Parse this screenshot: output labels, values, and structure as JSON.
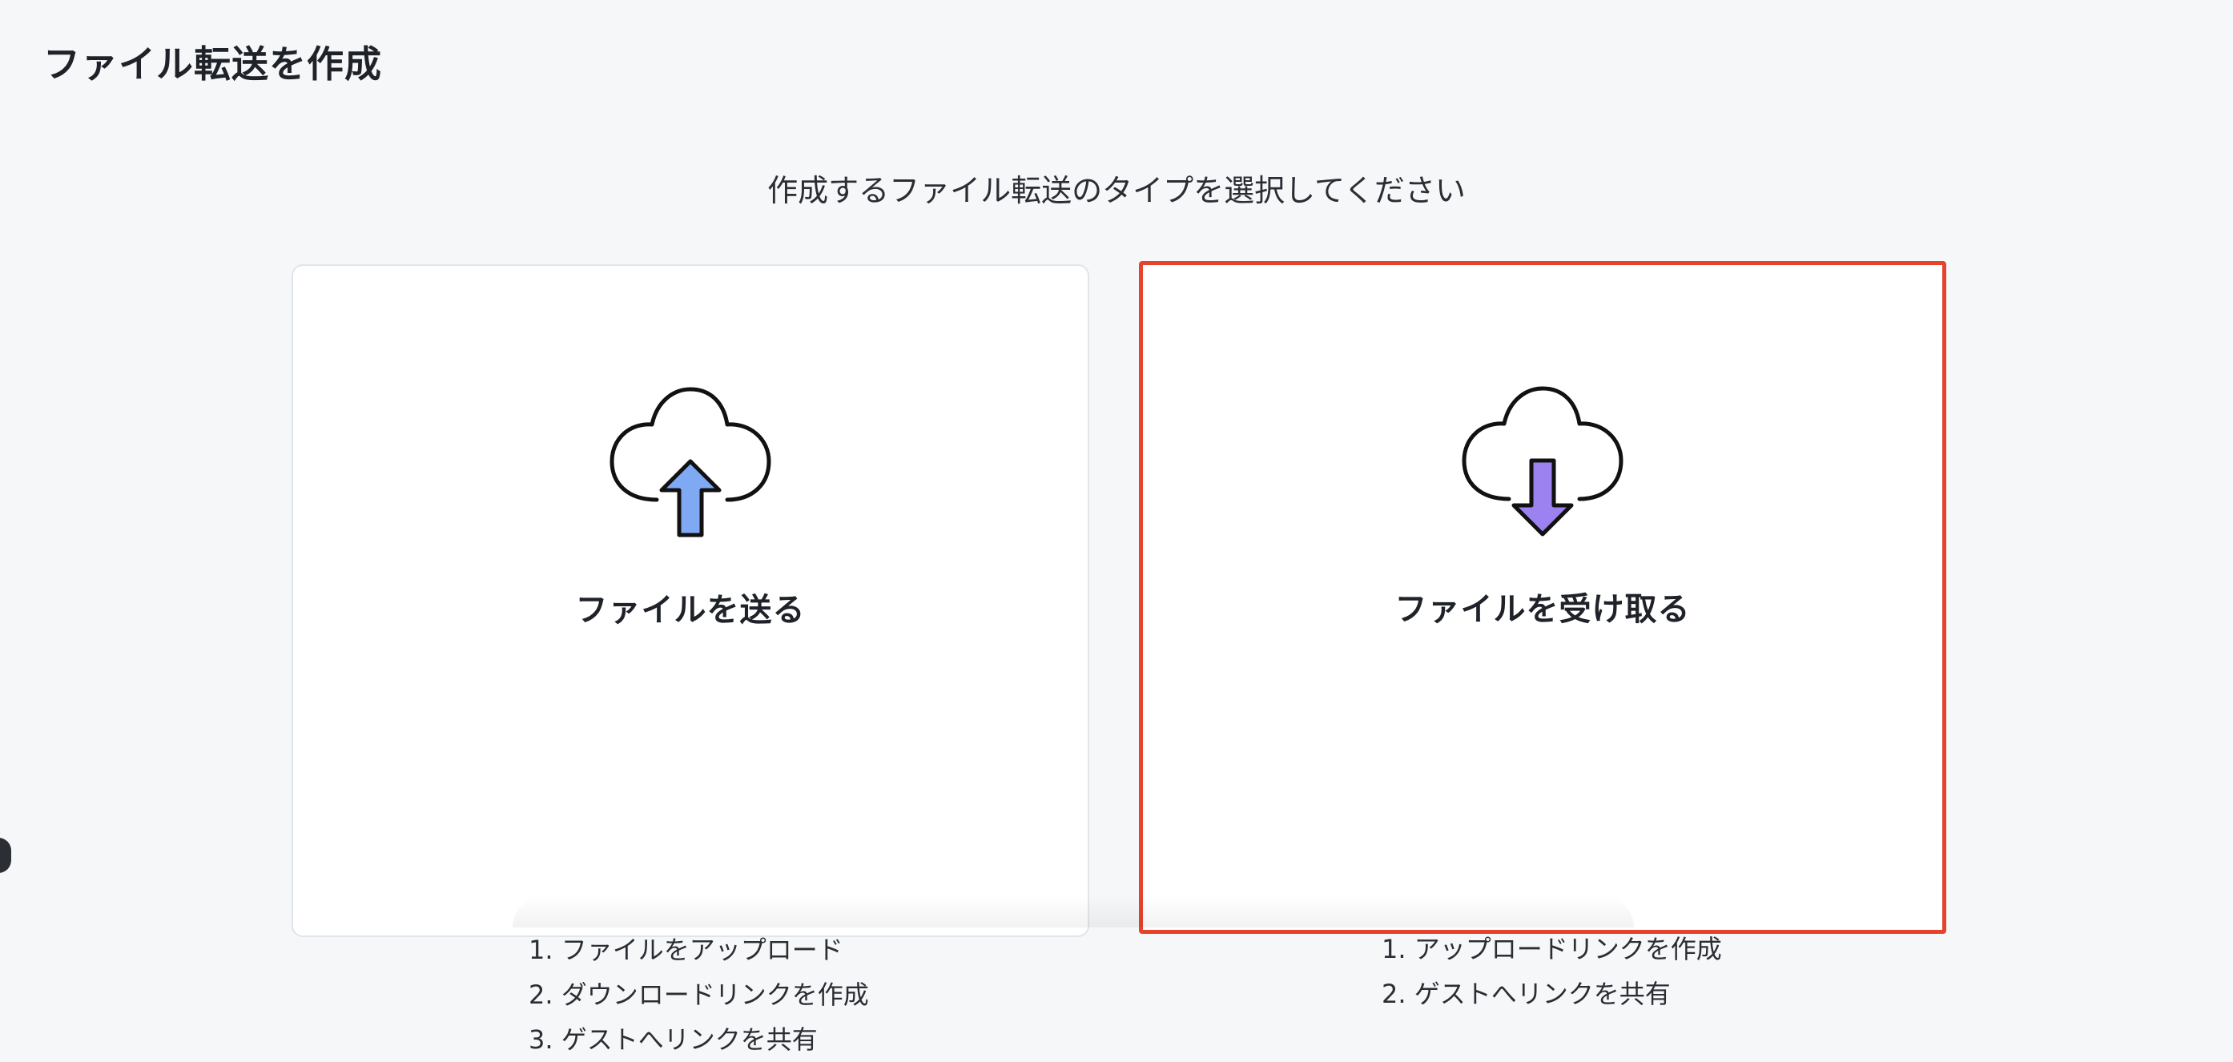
{
  "page": {
    "title": "ファイル転送を作成",
    "prompt": "作成するファイル転送のタイプを選択してください"
  },
  "cards": {
    "send": {
      "title": "ファイルを送る",
      "icon": "cloud-upload-icon",
      "steps": [
        "1. ファイルをアップロード",
        "2. ダウンロードリンクを作成",
        "3. ゲストへリンクを共有"
      ]
    },
    "receive": {
      "title": "ファイルを受け取る",
      "icon": "cloud-download-icon",
      "selected": true,
      "steps": [
        "1. アップロードリンクを作成",
        "2. ゲストへリンクを共有"
      ]
    }
  },
  "colors": {
    "background": "#f6f7f9",
    "card": "#ffffff",
    "selected_border": "#e5432d",
    "upload_arrow": "#7faaf3",
    "download_arrow": "#9b82f0",
    "text": "#1f2329"
  }
}
